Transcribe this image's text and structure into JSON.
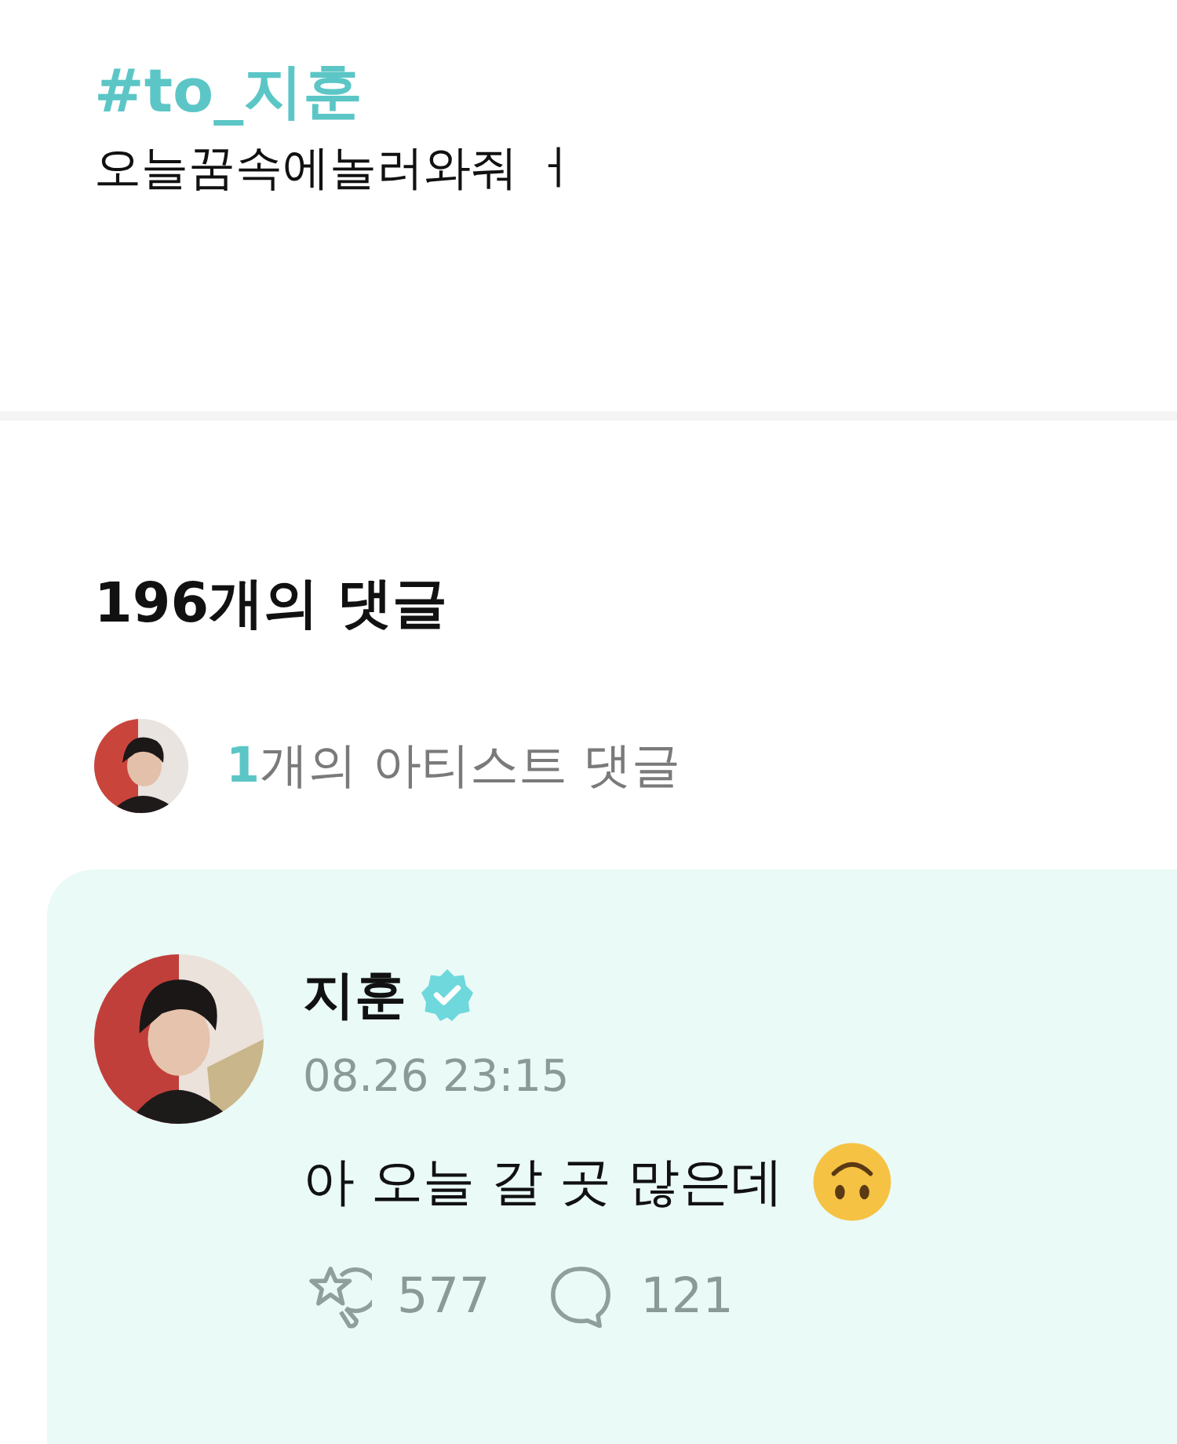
{
  "post": {
    "hashtag": "#to_지훈",
    "body": "오늘꿈속에놀러와줘 ㅓ"
  },
  "comments_header": {
    "title": "196개의 댓글",
    "artist_count": "1",
    "artist_label": "개의 아티스트 댓글"
  },
  "artist_comment": {
    "name": "지훈",
    "verified": true,
    "time": "08.26 23:15",
    "text": "아 오늘 갈 곳 많은데",
    "likes": "577",
    "replies": "121"
  }
}
